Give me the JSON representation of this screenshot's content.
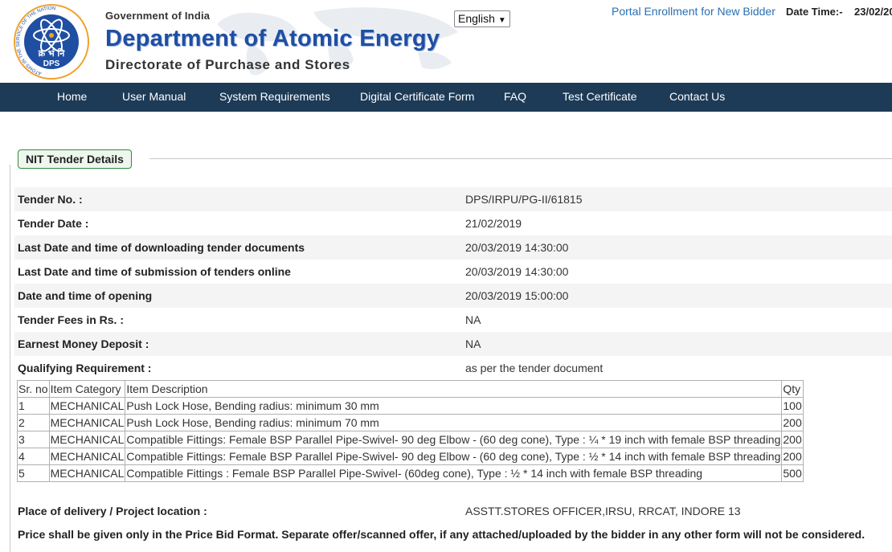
{
  "header": {
    "emblem_text": "क्र भं नि",
    "emblem_abbr": "DPS",
    "emblem_ring_text": "ATOMS IN THE SERVICE OF THE NATION",
    "gov_label": "Government of India",
    "dept_title": "Department of Atomic Energy",
    "directorate": "Directorate of Purchase and Stores",
    "language": "English",
    "enroll_link": "Portal Enrollment for New Bidder",
    "datetime_label": "Date Time:-",
    "datetime_value": "23/02/20"
  },
  "nav": [
    "Home",
    "User Manual",
    "System Requirements",
    "Digital Certificate Form",
    "FAQ",
    "Test Certificate",
    "Contact Us"
  ],
  "section_title": "NIT Tender Details",
  "details": [
    {
      "label": "Tender No. :",
      "value": "DPS/IRPU/PG-II/61815"
    },
    {
      "label": "Tender Date :",
      "value": "21/02/2019"
    },
    {
      "label": "Last Date and time of downloading tender documents",
      "value": "20/03/2019 14:30:00"
    },
    {
      "label": "Last Date and time of submission of tenders online",
      "value": "20/03/2019 14:30:00"
    },
    {
      "label": "Date and time of opening",
      "value": "20/03/2019 15:00:00"
    },
    {
      "label": "Tender Fees in Rs. :",
      "value": "NA"
    },
    {
      "label": "Earnest Money Deposit :",
      "value": "NA"
    },
    {
      "label": "Qualifying Requirement :",
      "value": "as per the tender document"
    }
  ],
  "items_table": {
    "headers": [
      "Sr. no",
      "Item Category",
      "Item Description",
      "Qty"
    ],
    "rows": [
      [
        "1",
        "MECHANICAL",
        "Push Lock Hose, Bending radius: minimum 30 mm",
        "100"
      ],
      [
        "2",
        "MECHANICAL",
        "Push Lock Hose, Bending radius: minimum 70 mm",
        "200"
      ],
      [
        "3",
        "MECHANICAL",
        "Compatible Fittings: Female BSP Parallel Pipe-Swivel- 90 deg Elbow - (60 deg cone), Type : ¼ * 19 inch with female BSP threading",
        "200"
      ],
      [
        "4",
        "MECHANICAL",
        "Compatible Fittings: Female BSP Parallel Pipe-Swivel- 90 deg Elbow - (60 deg cone), Type : ½ * 14 inch with female BSP threading",
        "200"
      ],
      [
        "5",
        "MECHANICAL",
        "Compatible Fittings : Female BSP Parallel Pipe-Swivel- (60deg cone), Type : ½ * 14 inch with female BSP threading",
        "500"
      ]
    ]
  },
  "delivery": {
    "label": "Place of delivery / Project location :",
    "value": "ASSTT.STORES OFFICER,IRSU, RRCAT, INDORE 13"
  },
  "note": "Price shall be given only in the Price Bid Format. Separate offer/scanned offer, if any attached/uploaded by the bidder in any other form will not be considered."
}
